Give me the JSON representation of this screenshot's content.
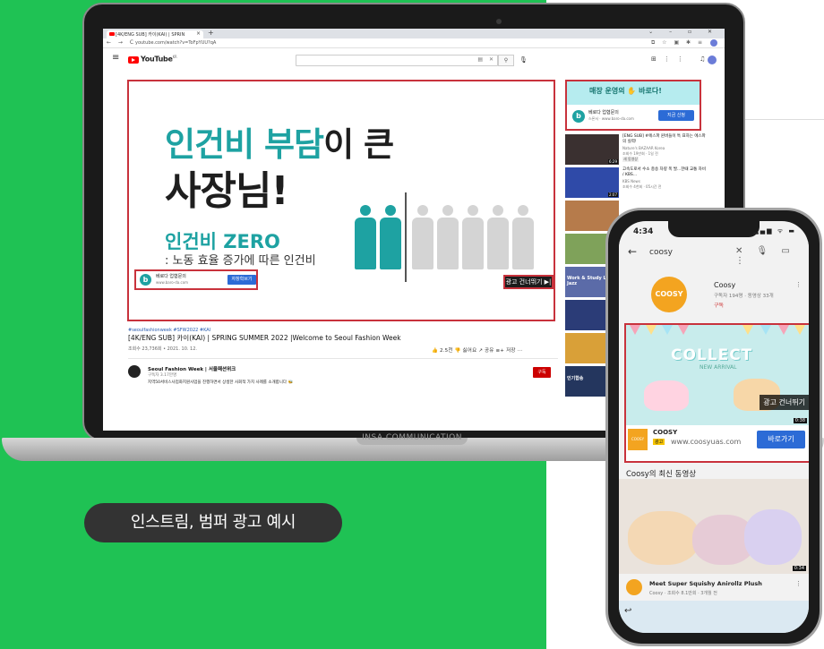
{
  "colors": {
    "brand_green": "#1fc254",
    "highlight_red": "#c8323c",
    "teal": "#1ea2a2",
    "button_blue": "#2c6bd6"
  },
  "browser": {
    "tab_title": "[4K/ENG SUB] 카이(KAI) | SPRIN",
    "url": "youtube.com/watch?v=ToFpYUU?qA",
    "new_tab": "+",
    "window_controls": "⌄ – ▫ ✕"
  },
  "youtube": {
    "logo_text": "YouTube",
    "logo_sup": "KR",
    "search_value": ""
  },
  "player_ad": {
    "headline_teal": "인건비 부담",
    "headline_dark": "이 큰",
    "line2": "사장님!",
    "zero_title": "인건비 ZERO",
    "description": ": 노동 효율 증가에 따른 인건비",
    "cta_name": "베로다 업협문의",
    "cta_url": "www.baro-da.com",
    "cta_button": "자창학브기",
    "skip_button": "광고 건너뛰기 ▶|"
  },
  "video": {
    "hashtags": "#seoulfashionweek #SFW2022 #KAI",
    "title": "[4K/ENG SUB] 카이(KAI) | SPRING SUMMER 2022 |Welcome to Seoul Fashion Week",
    "stats": "조회수 23,736회 • 2021. 10. 12.",
    "actions": "👍 2.5천   👎 싫어요   ↗ 공유   ≡+ 저장   ···",
    "channel_name": "Seoul Fashion Week | 서울패션위크",
    "channel_subs": "구독자 3.17만명",
    "channel_desc": "지역50서비스사업화지원사업을 진행하면서 상생한 사회적 가치 사례를 소개합니다 🐝",
    "subscribe": "구독"
  },
  "side_ad": {
    "banner_text": "매장 운영의 ✋ 바로다!",
    "name": "베로다 업협문의",
    "sponsor_url": "스폰서 · www.baro-da.com",
    "button": "지금 신청"
  },
  "recommendations": [
    {
      "title": "[ENG SUB] #에스파 윈버들이 특 표하는 에스파의 실력!",
      "channel": "Nature's BAZAAR Korea",
      "views": "조회수 19만회 · 1일 전",
      "badge": "새 동영상",
      "duration": "6:29",
      "thumb": "#3a3030"
    },
    {
      "title": "고속도로서 수소 충송 차량 폭 발...한때 교통 차비 / KBS...",
      "channel": "KBS News",
      "views": "조회수 4천회 · 05시간 전",
      "badge": "",
      "duration": "2:07",
      "thumb": "#2f4aa8"
    },
    {
      "title": "",
      "channel": "",
      "views": "",
      "badge": "",
      "duration": "",
      "thumb": "#b67b4b"
    },
    {
      "title": "",
      "channel": "",
      "views": "",
      "badge": "",
      "duration": "",
      "thumb": "#7fa25a"
    },
    {
      "title": "",
      "channel": "",
      "views": "",
      "badge": "",
      "duration": "",
      "thumb": "#5b6ba8"
    },
    {
      "title": "",
      "channel": "",
      "views": "",
      "badge": "",
      "duration": "",
      "thumb": "#2b3c77"
    },
    {
      "title": "",
      "channel": "",
      "views": "",
      "badge": "",
      "duration": "",
      "thumb": "#d9a038"
    },
    {
      "title": "",
      "channel": "",
      "views": "",
      "badge": "",
      "duration": "",
      "thumb": "#24365e"
    }
  ],
  "rec_thumb_labels": [
    "",
    "",
    "",
    "",
    "Work & Study Lo-Fi Jazz",
    "",
    "",
    "인기합송"
  ],
  "laptop_brand": "INSA COMMUNICATION",
  "caption": "인스트림, 범퍼 광고 예시",
  "phone": {
    "time": "4:34",
    "status": "▂▄▆ ᯤ ▬",
    "query": "coosy",
    "channel": {
      "logo": "COOSY",
      "name": "Coosy",
      "subs": "구독자 194명 · 동영상 33개",
      "subscribe": "구독"
    },
    "ad": {
      "collect": "COLLECT",
      "collect_sub": "NEW ARRIVAL",
      "skip": "광고 건너뛰기",
      "duration": "0:38",
      "name": "COOSY",
      "badge": "광고",
      "url": "www.coosyuas.com",
      "button": "바로가기"
    },
    "section_title": "Coosy의 최신 동영상",
    "video": {
      "duration": "0:34",
      "title": "Meet Super Squishy Anirollz Plush",
      "meta": "Coosy · 조회수 8.1만회 · 3개월 전"
    }
  }
}
